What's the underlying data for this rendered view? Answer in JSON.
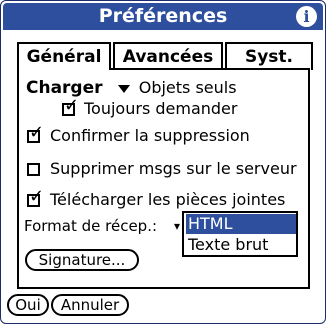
{
  "window": {
    "title": "Préférences",
    "info_icon": "i"
  },
  "tabs": [
    {
      "label": "Général",
      "active": true
    },
    {
      "label": "Avancées",
      "active": false
    },
    {
      "label": "Syst.",
      "active": false
    }
  ],
  "charger": {
    "label": "Charger",
    "value": "Objets seuls"
  },
  "options": {
    "toujours_demander": {
      "label": "Toujours demander",
      "checked": true
    },
    "confirmer": {
      "label": "Confirmer la suppression",
      "checked": true
    },
    "supprimer": {
      "label": "Supprimer msgs sur le serveur",
      "checked": false
    },
    "telecharger": {
      "label": "Télécharger les pièces jointes",
      "checked": true
    }
  },
  "format": {
    "label": "Format de récep.:",
    "options": [
      "HTML",
      "Texte brut"
    ],
    "selected": "HTML"
  },
  "buttons": {
    "signature": "Signature...",
    "ok": "Oui",
    "cancel": "Annuler"
  },
  "colors": {
    "accent": "#2d4f9e"
  },
  "check_glyph": "✓"
}
